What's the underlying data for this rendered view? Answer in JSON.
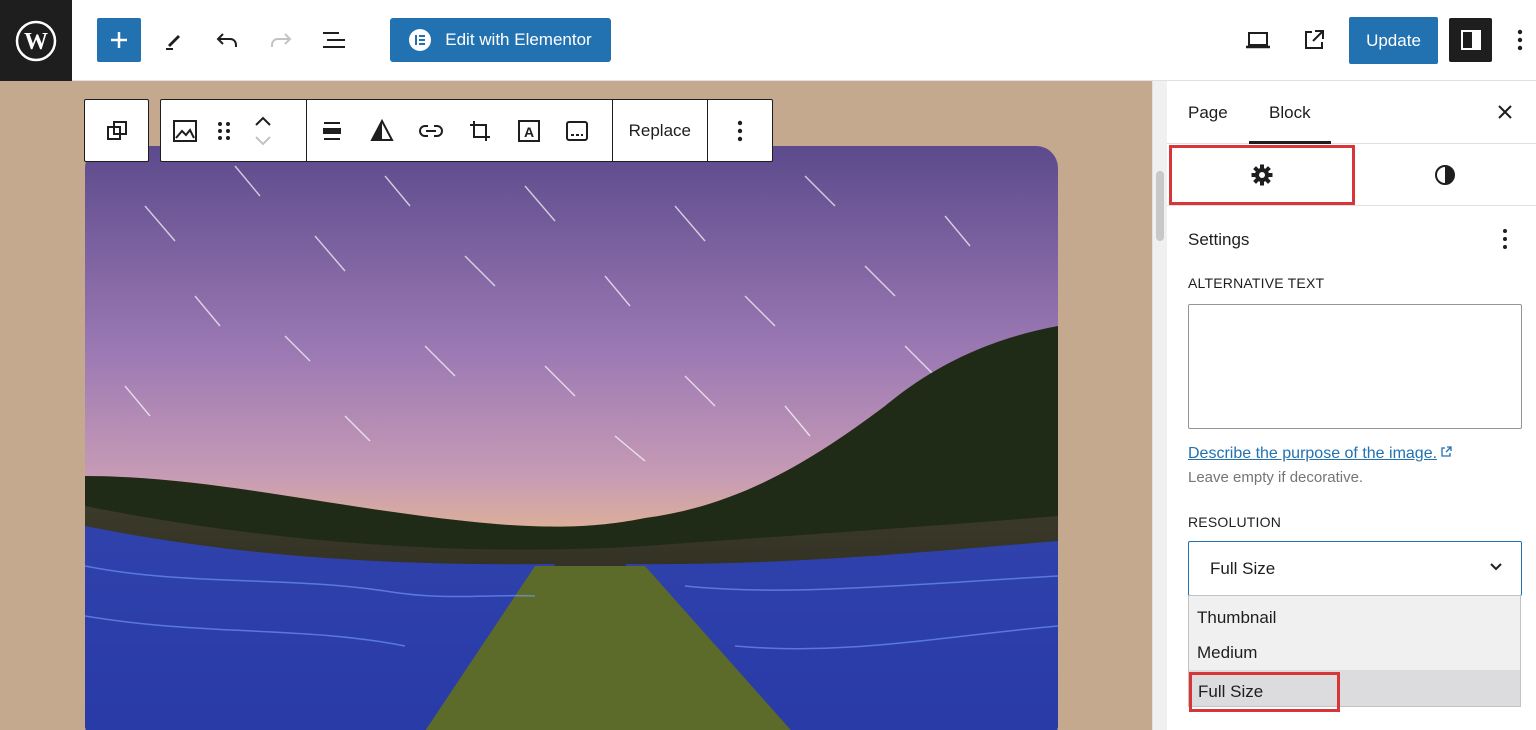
{
  "topbar": {
    "edit_elementor_label": "Edit with Elementor",
    "update_label": "Update",
    "icons": [
      "wordpress-logo-icon",
      "plus-icon",
      "pencil-icon",
      "undo-icon",
      "redo-icon",
      "list-view-icon",
      "laptop-preview-icon",
      "external-link-icon",
      "sidebar-toggle-icon",
      "more-vertical-icon"
    ]
  },
  "block_toolbar": {
    "replace_label": "Replace",
    "icons": [
      "duplicate-icon",
      "image-icon",
      "drag-handle-icon",
      "move-up-icon",
      "move-down-icon",
      "align-icon",
      "duotone-icon",
      "link-icon",
      "crop-icon",
      "text-over-image-icon",
      "caption-icon",
      "more-vertical-icon"
    ]
  },
  "sidebar": {
    "tabs": {
      "page": "Page",
      "block": "Block"
    },
    "panel_title": "Settings",
    "alt_text": {
      "label": "ALTERNATIVE TEXT",
      "value": "",
      "link": "Describe the purpose of the image.",
      "help": "Leave empty if decorative."
    },
    "resolution": {
      "label": "RESOLUTION",
      "selected": "Full Size",
      "options": [
        "Thumbnail",
        "Medium",
        "Full Size"
      ]
    }
  },
  "colors": {
    "accent": "#2271b1",
    "highlight_border": "#d63638",
    "canvas_bg": "#c4a98f"
  }
}
